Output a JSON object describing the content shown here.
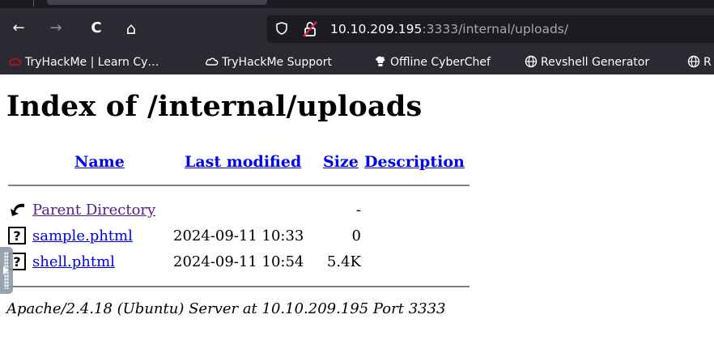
{
  "browser": {
    "nav": {
      "back": "←",
      "forward": "→",
      "reload": "C",
      "home": "⌂"
    },
    "url": {
      "host": "10.10.209.195",
      "rest": ":3333/internal/uploads/"
    },
    "bookmarks": [
      {
        "label": "TryHackMe | Learn Cy…",
        "icon": "tryhackme-icon"
      },
      {
        "label": "TryHackMe Support",
        "icon": "cloud-icon"
      },
      {
        "label": "Offline CyberChef",
        "icon": "cyberchef-icon"
      },
      {
        "label": "Revshell Generator",
        "icon": "globe-icon"
      },
      {
        "label": "R",
        "icon": "globe-icon"
      }
    ],
    "colors": {
      "chrome": "#2b2a33",
      "tabstrip": "#1c1b22",
      "urlbar": "#1c1b22",
      "text": "#fbfbfe",
      "lock_warning": "#e22850"
    }
  },
  "page": {
    "title": "Index of /internal/uploads",
    "headers": {
      "name": "Name",
      "modified": "Last modified",
      "size": "Size",
      "description": "Description"
    },
    "parent": {
      "name": "Parent Directory",
      "size": "-"
    },
    "files": [
      {
        "name": "sample.phtml",
        "modified": "2024-09-11 10:33",
        "size": "0",
        "icon": "unknown-file-icon"
      },
      {
        "name": "shell.phtml",
        "modified": "2024-09-11 10:54",
        "size": "5.4K",
        "icon": "unknown-file-icon"
      }
    ],
    "footer": "Apache/2.4.18 (Ubuntu) Server at 10.10.209.195 Port 3333",
    "colors": {
      "link": "#0000ee",
      "visited": "#551a8b"
    }
  }
}
